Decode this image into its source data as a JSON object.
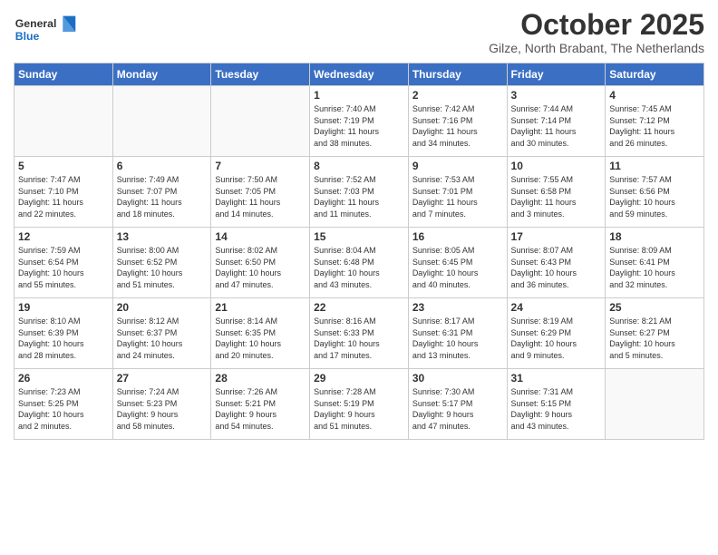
{
  "header": {
    "logo_general": "General",
    "logo_blue": "Blue",
    "month": "October 2025",
    "location": "Gilze, North Brabant, The Netherlands"
  },
  "weekdays": [
    "Sunday",
    "Monday",
    "Tuesday",
    "Wednesday",
    "Thursday",
    "Friday",
    "Saturday"
  ],
  "weeks": [
    [
      {
        "day": "",
        "info": ""
      },
      {
        "day": "",
        "info": ""
      },
      {
        "day": "",
        "info": ""
      },
      {
        "day": "1",
        "info": "Sunrise: 7:40 AM\nSunset: 7:19 PM\nDaylight: 11 hours\nand 38 minutes."
      },
      {
        "day": "2",
        "info": "Sunrise: 7:42 AM\nSunset: 7:16 PM\nDaylight: 11 hours\nand 34 minutes."
      },
      {
        "day": "3",
        "info": "Sunrise: 7:44 AM\nSunset: 7:14 PM\nDaylight: 11 hours\nand 30 minutes."
      },
      {
        "day": "4",
        "info": "Sunrise: 7:45 AM\nSunset: 7:12 PM\nDaylight: 11 hours\nand 26 minutes."
      }
    ],
    [
      {
        "day": "5",
        "info": "Sunrise: 7:47 AM\nSunset: 7:10 PM\nDaylight: 11 hours\nand 22 minutes."
      },
      {
        "day": "6",
        "info": "Sunrise: 7:49 AM\nSunset: 7:07 PM\nDaylight: 11 hours\nand 18 minutes."
      },
      {
        "day": "7",
        "info": "Sunrise: 7:50 AM\nSunset: 7:05 PM\nDaylight: 11 hours\nand 14 minutes."
      },
      {
        "day": "8",
        "info": "Sunrise: 7:52 AM\nSunset: 7:03 PM\nDaylight: 11 hours\nand 11 minutes."
      },
      {
        "day": "9",
        "info": "Sunrise: 7:53 AM\nSunset: 7:01 PM\nDaylight: 11 hours\nand 7 minutes."
      },
      {
        "day": "10",
        "info": "Sunrise: 7:55 AM\nSunset: 6:58 PM\nDaylight: 11 hours\nand 3 minutes."
      },
      {
        "day": "11",
        "info": "Sunrise: 7:57 AM\nSunset: 6:56 PM\nDaylight: 10 hours\nand 59 minutes."
      }
    ],
    [
      {
        "day": "12",
        "info": "Sunrise: 7:59 AM\nSunset: 6:54 PM\nDaylight: 10 hours\nand 55 minutes."
      },
      {
        "day": "13",
        "info": "Sunrise: 8:00 AM\nSunset: 6:52 PM\nDaylight: 10 hours\nand 51 minutes."
      },
      {
        "day": "14",
        "info": "Sunrise: 8:02 AM\nSunset: 6:50 PM\nDaylight: 10 hours\nand 47 minutes."
      },
      {
        "day": "15",
        "info": "Sunrise: 8:04 AM\nSunset: 6:48 PM\nDaylight: 10 hours\nand 43 minutes."
      },
      {
        "day": "16",
        "info": "Sunrise: 8:05 AM\nSunset: 6:45 PM\nDaylight: 10 hours\nand 40 minutes."
      },
      {
        "day": "17",
        "info": "Sunrise: 8:07 AM\nSunset: 6:43 PM\nDaylight: 10 hours\nand 36 minutes."
      },
      {
        "day": "18",
        "info": "Sunrise: 8:09 AM\nSunset: 6:41 PM\nDaylight: 10 hours\nand 32 minutes."
      }
    ],
    [
      {
        "day": "19",
        "info": "Sunrise: 8:10 AM\nSunset: 6:39 PM\nDaylight: 10 hours\nand 28 minutes."
      },
      {
        "day": "20",
        "info": "Sunrise: 8:12 AM\nSunset: 6:37 PM\nDaylight: 10 hours\nand 24 minutes."
      },
      {
        "day": "21",
        "info": "Sunrise: 8:14 AM\nSunset: 6:35 PM\nDaylight: 10 hours\nand 20 minutes."
      },
      {
        "day": "22",
        "info": "Sunrise: 8:16 AM\nSunset: 6:33 PM\nDaylight: 10 hours\nand 17 minutes."
      },
      {
        "day": "23",
        "info": "Sunrise: 8:17 AM\nSunset: 6:31 PM\nDaylight: 10 hours\nand 13 minutes."
      },
      {
        "day": "24",
        "info": "Sunrise: 8:19 AM\nSunset: 6:29 PM\nDaylight: 10 hours\nand 9 minutes."
      },
      {
        "day": "25",
        "info": "Sunrise: 8:21 AM\nSunset: 6:27 PM\nDaylight: 10 hours\nand 5 minutes."
      }
    ],
    [
      {
        "day": "26",
        "info": "Sunrise: 7:23 AM\nSunset: 5:25 PM\nDaylight: 10 hours\nand 2 minutes."
      },
      {
        "day": "27",
        "info": "Sunrise: 7:24 AM\nSunset: 5:23 PM\nDaylight: 9 hours\nand 58 minutes."
      },
      {
        "day": "28",
        "info": "Sunrise: 7:26 AM\nSunset: 5:21 PM\nDaylight: 9 hours\nand 54 minutes."
      },
      {
        "day": "29",
        "info": "Sunrise: 7:28 AM\nSunset: 5:19 PM\nDaylight: 9 hours\nand 51 minutes."
      },
      {
        "day": "30",
        "info": "Sunrise: 7:30 AM\nSunset: 5:17 PM\nDaylight: 9 hours\nand 47 minutes."
      },
      {
        "day": "31",
        "info": "Sunrise: 7:31 AM\nSunset: 5:15 PM\nDaylight: 9 hours\nand 43 minutes."
      },
      {
        "day": "",
        "info": ""
      }
    ]
  ]
}
